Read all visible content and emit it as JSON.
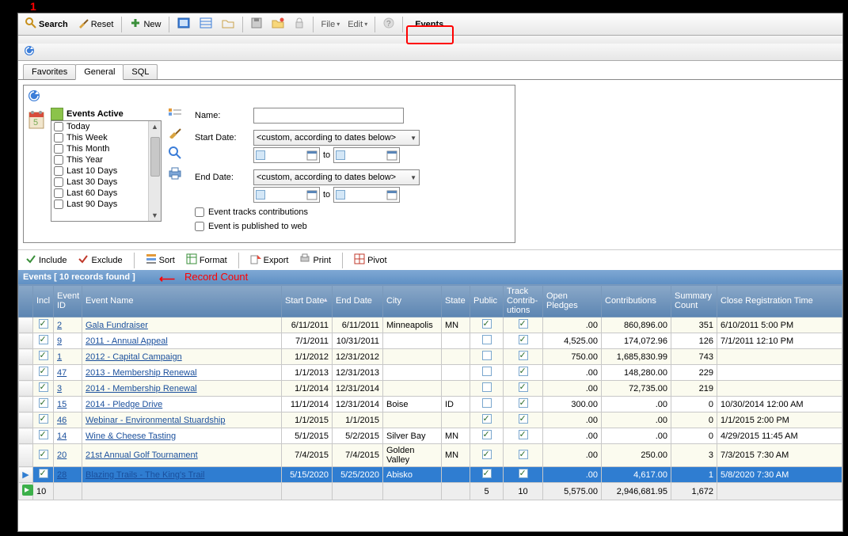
{
  "annotations": {
    "one": "1",
    "record_count": "Record Count"
  },
  "toolbar": {
    "search": "Search",
    "reset": "Reset",
    "new": "New",
    "file": "File",
    "edit": "Edit",
    "events": "Events"
  },
  "tabs": {
    "favorites": "Favorites",
    "general": "General",
    "sql": "SQL"
  },
  "filter": {
    "title": "Events Active",
    "date_ranges": [
      "Today",
      "This Week",
      "This Month",
      "This Year",
      "Last 10 Days",
      "Last 30 Days",
      "Last 60 Days",
      "Last 90 Days"
    ],
    "name_label": "Name:",
    "start_date_label": "Start Date:",
    "end_date_label": "End Date:",
    "combo_text": "<custom, according to dates below>",
    "to": "to",
    "tracks": "Event tracks contributions",
    "published": "Event is published to web"
  },
  "grid_toolbar": {
    "include": "Include",
    "exclude": "Exclude",
    "sort": "Sort",
    "format": "Format",
    "export": "Export",
    "print": "Print",
    "pivot": "Pivot"
  },
  "record_bar": "Events [ 10 records found ]",
  "columns": {
    "incl": "Incl",
    "id": "Event ID",
    "name": "Event Name",
    "start": "Start Date",
    "end": "End Date",
    "city": "City",
    "state": "State",
    "public": "Public",
    "track": "Track Contrib-utions",
    "pledges": "Open Pledges",
    "contrib": "Contributions",
    "summary": "Summary Count",
    "close": "Close Registration Time"
  },
  "rows": [
    {
      "incl": true,
      "id": "2",
      "name": "Gala Fundraiser",
      "start": "6/11/2011",
      "end": "6/11/2011",
      "city": "Minneapolis",
      "state": "MN",
      "pub": true,
      "track": true,
      "pledges": ".00",
      "contrib": "860,896.00",
      "summary": "351",
      "close": "6/10/2011 5:00 PM"
    },
    {
      "incl": true,
      "id": "9",
      "name": "2011 - Annual Appeal",
      "start": "7/1/2011",
      "end": "10/31/2011",
      "city": "",
      "state": "",
      "pub": false,
      "track": true,
      "pledges": "4,525.00",
      "contrib": "174,072.96",
      "summary": "126",
      "close": "7/1/2011 12:10 PM"
    },
    {
      "incl": true,
      "id": "1",
      "name": "2012 - Capital Campaign",
      "start": "1/1/2012",
      "end": "12/31/2012",
      "city": "",
      "state": "",
      "pub": false,
      "track": true,
      "pledges": "750.00",
      "contrib": "1,685,830.99",
      "summary": "743",
      "close": ""
    },
    {
      "incl": true,
      "id": "47",
      "name": "2013 - Membership Renewal",
      "start": "1/1/2013",
      "end": "12/31/2013",
      "city": "",
      "state": "",
      "pub": false,
      "track": true,
      "pledges": ".00",
      "contrib": "148,280.00",
      "summary": "229",
      "close": ""
    },
    {
      "incl": true,
      "id": "3",
      "name": "2014 - Membership Renewal",
      "start": "1/1/2014",
      "end": "12/31/2014",
      "city": "",
      "state": "",
      "pub": false,
      "track": true,
      "pledges": ".00",
      "contrib": "72,735.00",
      "summary": "219",
      "close": ""
    },
    {
      "incl": true,
      "id": "15",
      "name": "2014 - Pledge Drive",
      "start": "11/1/2014",
      "end": "12/31/2014",
      "city": "Boise",
      "state": "ID",
      "pub": false,
      "track": true,
      "pledges": "300.00",
      "contrib": ".00",
      "summary": "0",
      "close": "10/30/2014 12:00 AM"
    },
    {
      "incl": true,
      "id": "46",
      "name": "Webinar - Environmental Stuardship",
      "start": "1/1/2015",
      "end": "1/1/2015",
      "city": "",
      "state": "",
      "pub": true,
      "track": true,
      "pledges": ".00",
      "contrib": ".00",
      "summary": "0",
      "close": "1/1/2015 2:00 PM"
    },
    {
      "incl": true,
      "id": "14",
      "name": "Wine & Cheese Tasting",
      "start": "5/1/2015",
      "end": "5/2/2015",
      "city": "Silver Bay",
      "state": "MN",
      "pub": true,
      "track": true,
      "pledges": ".00",
      "contrib": ".00",
      "summary": "0",
      "close": "4/29/2015 11:45 AM"
    },
    {
      "incl": true,
      "id": "20",
      "name": "21st Annual Golf Tournament",
      "start": "7/4/2015",
      "end": "7/4/2015",
      "city": "Golden Valley",
      "state": "MN",
      "pub": true,
      "track": true,
      "pledges": ".00",
      "contrib": "250.00",
      "summary": "3",
      "close": "7/3/2015 7:30 AM"
    },
    {
      "incl": true,
      "id": "28",
      "name": "Blazing Trails - The King's Trail",
      "start": "5/15/2020",
      "end": "5/25/2020",
      "city": "Abisko",
      "state": "",
      "pub": true,
      "track": true,
      "pledges": ".00",
      "contrib": "4,617.00",
      "summary": "1",
      "close": "5/8/2020 7:30 AM"
    }
  ],
  "footer": {
    "count": "10",
    "public": "5",
    "track": "10",
    "pledges": "5,575.00",
    "contrib": "2,946,681.95",
    "summary": "1,672"
  }
}
